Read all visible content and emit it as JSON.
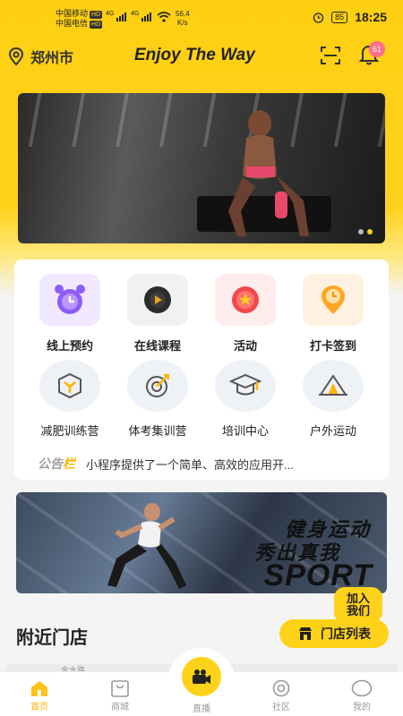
{
  "status_bar": {
    "carrier1": "中国移动",
    "carrier2": "中国电信",
    "hd": "HD",
    "net1": "4G",
    "net2": "4G",
    "speed_value": "56.4",
    "speed_unit": "K/s",
    "battery": "85",
    "time": "18:25"
  },
  "header": {
    "city": "郑州市",
    "title": "Enjoy The Way",
    "notification_count": "61"
  },
  "banner": {
    "active_dot": 2,
    "dot_count": 2
  },
  "menu_row1": [
    {
      "label": "线上预约",
      "icon": "alarm-clock-icon"
    },
    {
      "label": "在线课程",
      "icon": "play-icon"
    },
    {
      "label": "活动",
      "icon": "star-medal-icon"
    },
    {
      "label": "打卡签到",
      "icon": "clock-pin-icon"
    }
  ],
  "menu_row2": [
    {
      "label": "减肥训练营",
      "icon": "cube-icon"
    },
    {
      "label": "体考集训营",
      "icon": "target-icon"
    },
    {
      "label": "培训中心",
      "icon": "graduation-cap-icon"
    },
    {
      "label": "户外运动",
      "icon": "tent-icon"
    }
  ],
  "notice": {
    "tag_part1": "公告",
    "tag_part2": "栏",
    "text": "小程序提供了一个简单、高效的应用开..."
  },
  "promo_banner": {
    "line1": "健身运动",
    "line2": "秀出真我",
    "line3": "SPORT"
  },
  "join_button": {
    "line1": "加入",
    "line2": "我们"
  },
  "nearby": {
    "title": "附近门店",
    "store_list_button": "门店列表",
    "map_text": "金水路"
  },
  "tabbar": {
    "home": "首页",
    "mall": "商城",
    "live": "直播",
    "community": "社区",
    "mine": "我的"
  },
  "colors": {
    "accent": "#ffd21a",
    "badge": "#ff6d8c",
    "active_tab": "#ffb400"
  }
}
